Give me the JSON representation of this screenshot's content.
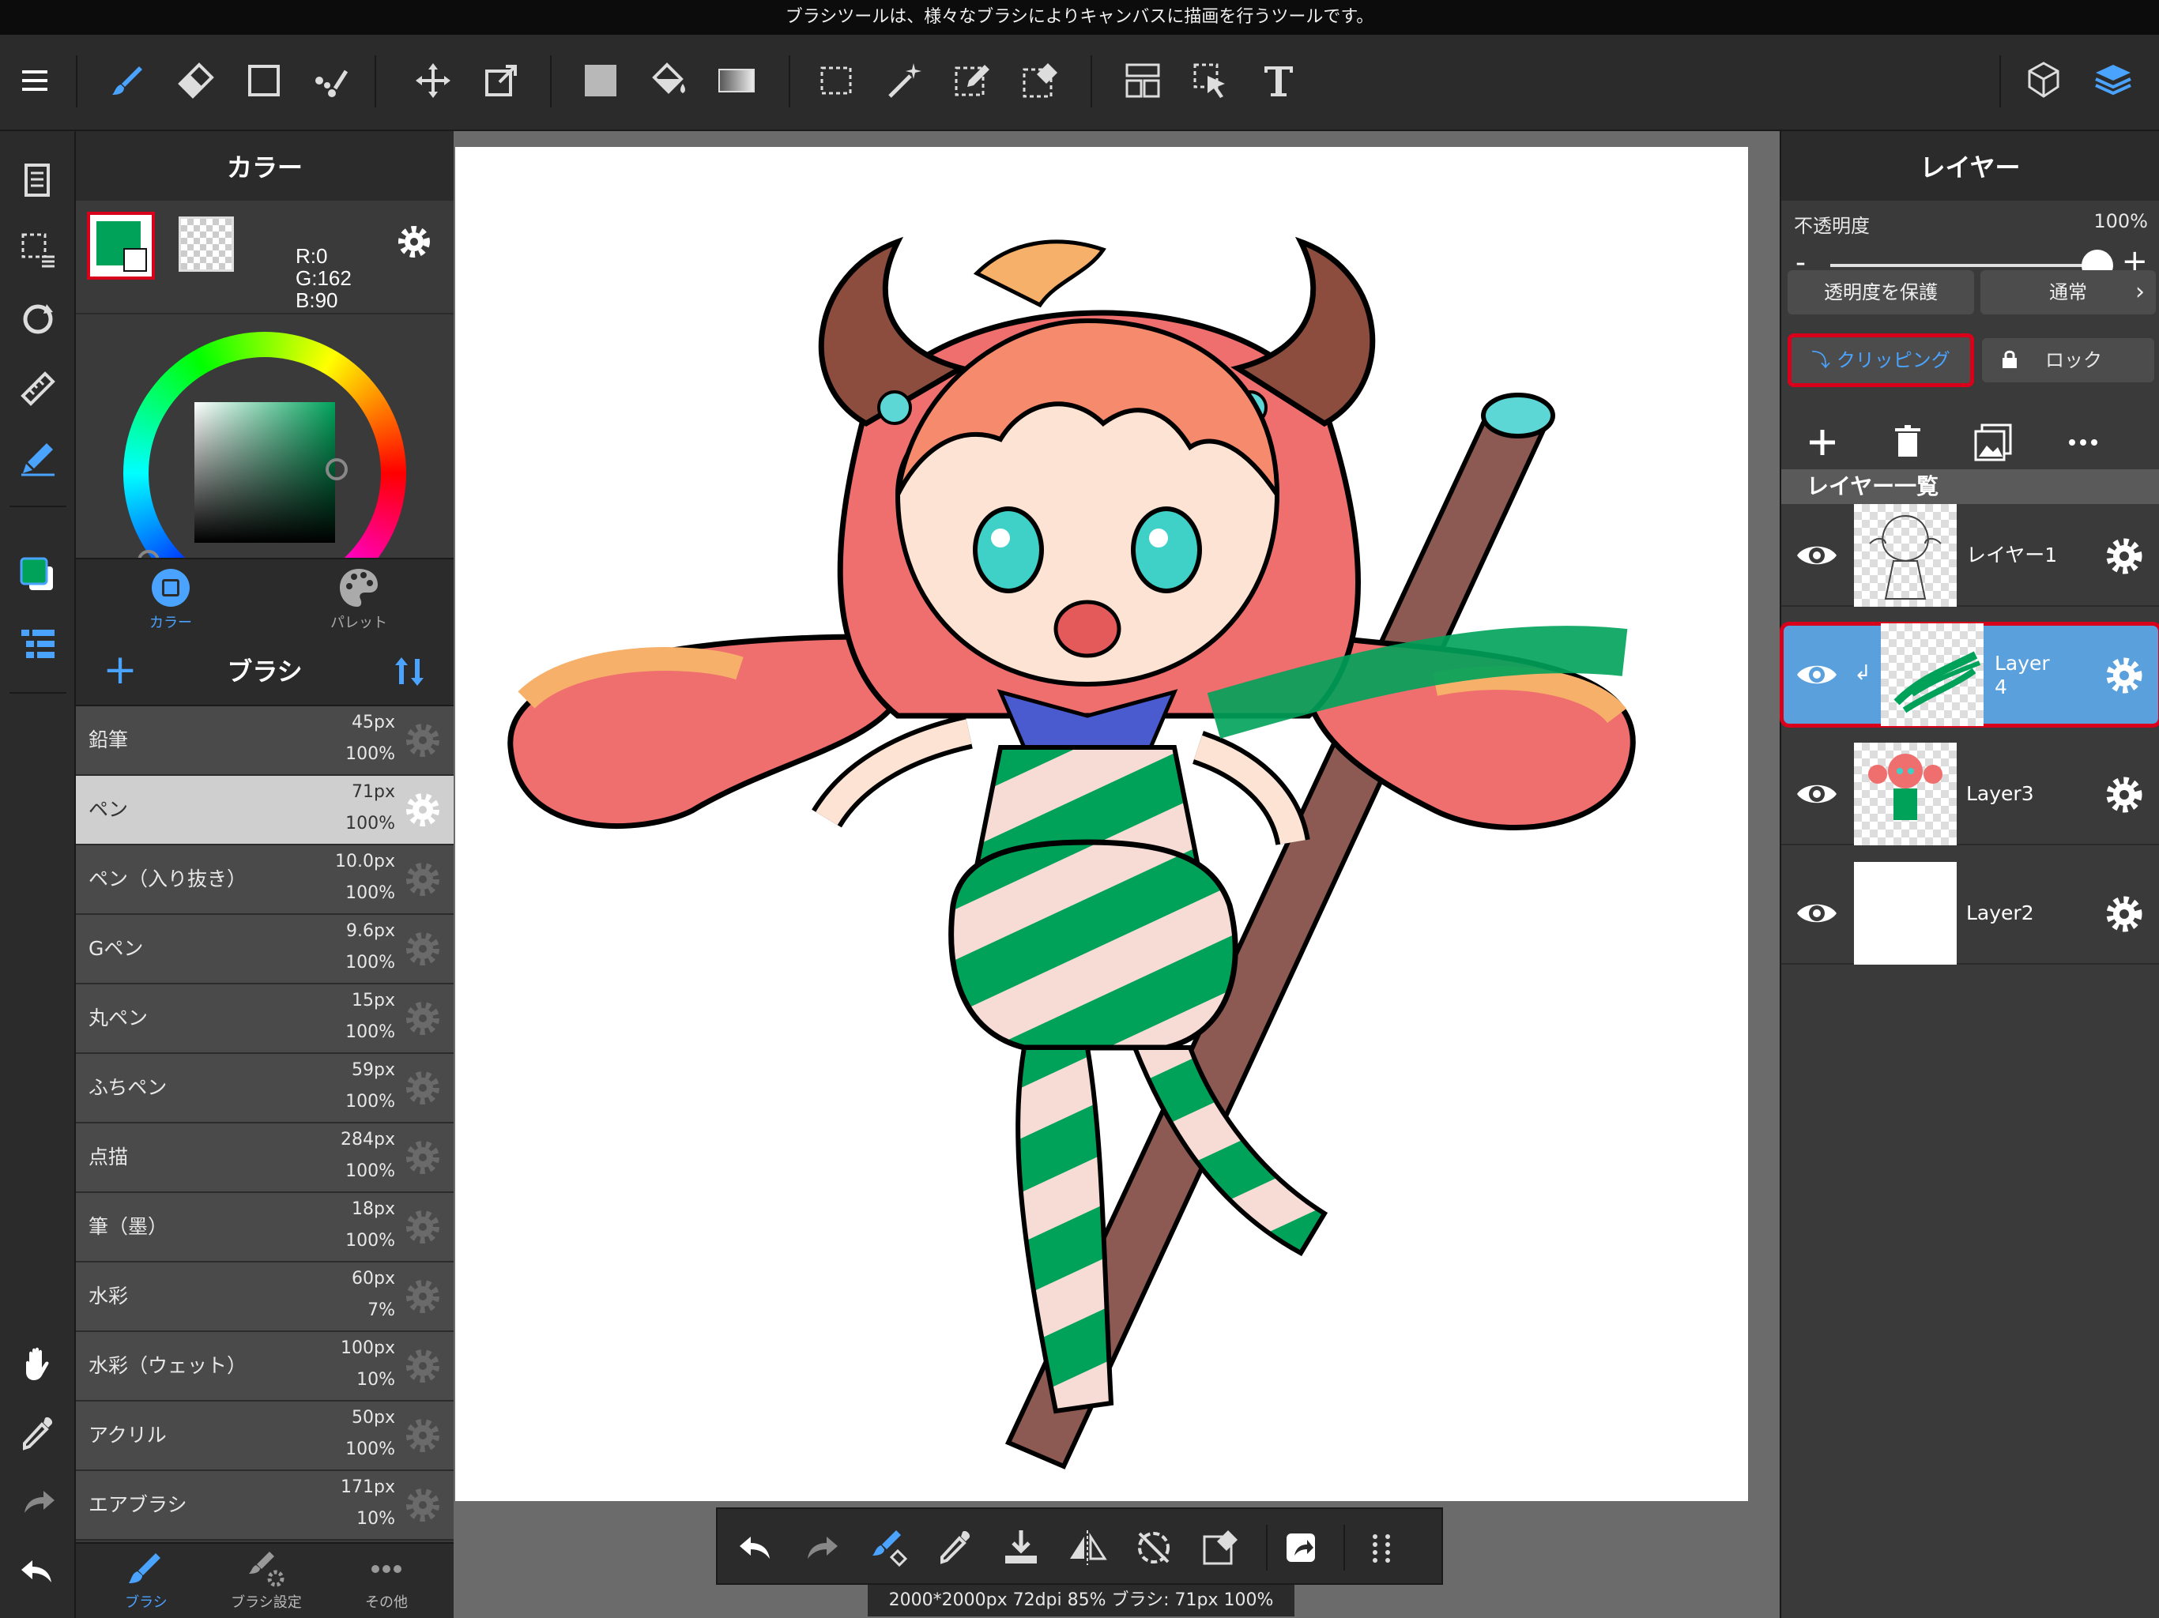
{
  "hint": {
    "text": "ブラシツールは、様々なブラシによりキャンバスに描画を行うツールです。"
  },
  "toolbar": {
    "icons": [
      "menu-icon",
      "brush-icon",
      "eraser-icon",
      "rectangle-icon",
      "dot-icon",
      "move-icon",
      "transform-icon",
      "fill-color-icon",
      "bucket-icon",
      "gradient-icon",
      "select-rect-icon",
      "magic-wand-icon",
      "select-pen-icon",
      "select-eraser-icon",
      "panel-layout-icon",
      "select-layer-icon",
      "text-icon",
      "3d-material-icon",
      "layers-icon"
    ]
  },
  "color_panel": {
    "title": "カラー",
    "fg_color": "#00a25a",
    "rgb": {
      "r": "R:0",
      "g": "G:162",
      "b": "B:90"
    },
    "tabs": {
      "color": "カラー",
      "palette": "パレット"
    }
  },
  "brush_panel": {
    "title": "ブラシ",
    "items": [
      {
        "name": "鉛筆",
        "size": "45px",
        "opacity": "100%",
        "active": false
      },
      {
        "name": "ペン",
        "size": "71px",
        "opacity": "100%",
        "active": true
      },
      {
        "name": "ペン（入り抜き）",
        "size": "10.0px",
        "opacity": "100%",
        "active": false
      },
      {
        "name": "Gペン",
        "size": "9.6px",
        "opacity": "100%",
        "active": false
      },
      {
        "name": "丸ペン",
        "size": "15px",
        "opacity": "100%",
        "active": false
      },
      {
        "name": "ふちペン",
        "size": "59px",
        "opacity": "100%",
        "active": false
      },
      {
        "name": "点描",
        "size": "284px",
        "opacity": "100%",
        "active": false
      },
      {
        "name": "筆（墨）",
        "size": "18px",
        "opacity": "100%",
        "active": false
      },
      {
        "name": "水彩",
        "size": "60px",
        "opacity": "7%",
        "active": false
      },
      {
        "name": "水彩（ウェット）",
        "size": "100px",
        "opacity": "10%",
        "active": false
      },
      {
        "name": "アクリル",
        "size": "50px",
        "opacity": "100%",
        "active": false
      },
      {
        "name": "エアブラシ",
        "size": "171px",
        "opacity": "10%",
        "active": false
      }
    ],
    "tabs": {
      "brush": "ブラシ",
      "brush_settings": "ブラシ設定",
      "other": "その他"
    }
  },
  "status": {
    "info": "2000*2000px 72dpi 85% ブラシ: 71px 100%"
  },
  "layer_panel": {
    "title": "レイヤー",
    "opacity_label": "不透明度",
    "opacity_value": "100%",
    "opacity_level": 1.0,
    "minus": "-",
    "plus": "+",
    "protect_alpha": "透明度を保護",
    "blend_mode": "通常",
    "clipping": "クリッピング",
    "lock": "ロック",
    "list_title": "レイヤー一覧",
    "layers": [
      {
        "name": "レイヤー1",
        "visible": true,
        "active": false,
        "clipped": false
      },
      {
        "name": "Layer 4",
        "visible": true,
        "active": true,
        "clipped": true
      },
      {
        "name": "Layer3",
        "visible": true,
        "active": false,
        "clipped": false
      },
      {
        "name": "Layer2",
        "visible": true,
        "active": false,
        "clipped": false
      }
    ]
  },
  "colors": {
    "accent_blue": "#4aa3ff",
    "highlight_red": "#d9001b",
    "brush_green": "#00a25a",
    "layer_active": "#5aa0dc"
  }
}
